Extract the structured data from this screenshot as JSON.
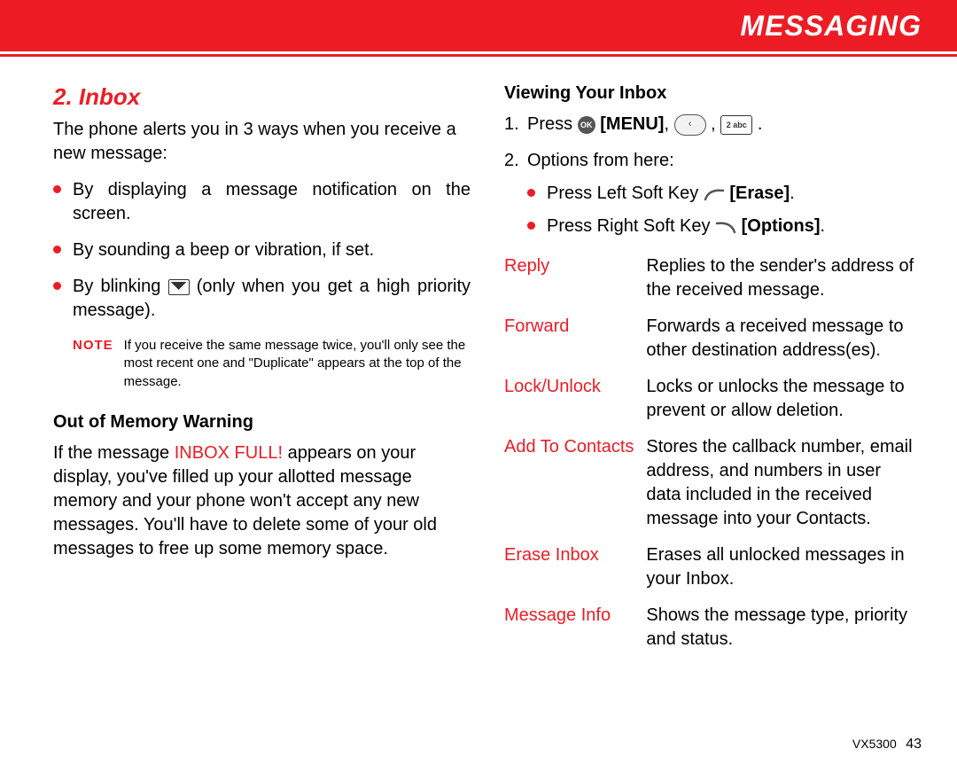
{
  "banner": {
    "title": "MESSAGING"
  },
  "left": {
    "section_title": "2. Inbox",
    "intro": "The phone alerts you in 3 ways when you receive a new message:",
    "bullets": {
      "b1": "By displaying a message notification on the screen.",
      "b2": "By sounding a beep or vibration, if set.",
      "b3a": "By blinking ",
      "b3b": " (only when you get a high priority message)."
    },
    "note_label": "NOTE",
    "note_text": "If you receive the same message twice, you'll only see the most recent one and \"Duplicate\" appears at the top of the message.",
    "oom_heading": "Out of Memory Warning",
    "oom_p1a": "If the message ",
    "oom_inbox_full": "INBOX FULL!",
    "oom_p1b": " appears on your display, you've filled up your allotted message memory and your phone won't accept any new messages. You'll have to delete some of your old messages to free up some memory space."
  },
  "right": {
    "heading": "Viewing Your Inbox",
    "step1_a": "Press ",
    "step1_menu": "[MENU]",
    "step1_mid": ",  ",
    "step1_mid2": " ,  ",
    "step1_end": " .",
    "step2": "Options from here:",
    "opt_left_a": "Press Left Soft Key ",
    "opt_left_b": "[Erase]",
    "opt_left_c": ".",
    "opt_right_a": "Press Right Soft Key ",
    "opt_right_b": "[Options]",
    "opt_right_c": ".",
    "table": [
      {
        "term": "Reply",
        "desc": "Replies to the sender's address of the received message."
      },
      {
        "term": "Forward",
        "desc": "Forwards a received message to other destination address(es)."
      },
      {
        "term": "Lock/Unlock",
        "desc": "Locks or unlocks the message to prevent or allow deletion."
      },
      {
        "term": "Add To Contacts",
        "desc": "Stores the callback number, email address, and numbers in user data included in the received message into your Contacts."
      },
      {
        "term": "Erase Inbox",
        "desc": "Erases all unlocked messages in your Inbox."
      },
      {
        "term": "Message Info",
        "desc": "Shows the message type, priority and status."
      }
    ]
  },
  "footer": {
    "model": "VX5300",
    "page": "43"
  },
  "icons": {
    "ok": "OK",
    "arrow": "‹",
    "abc": "2 abc"
  }
}
